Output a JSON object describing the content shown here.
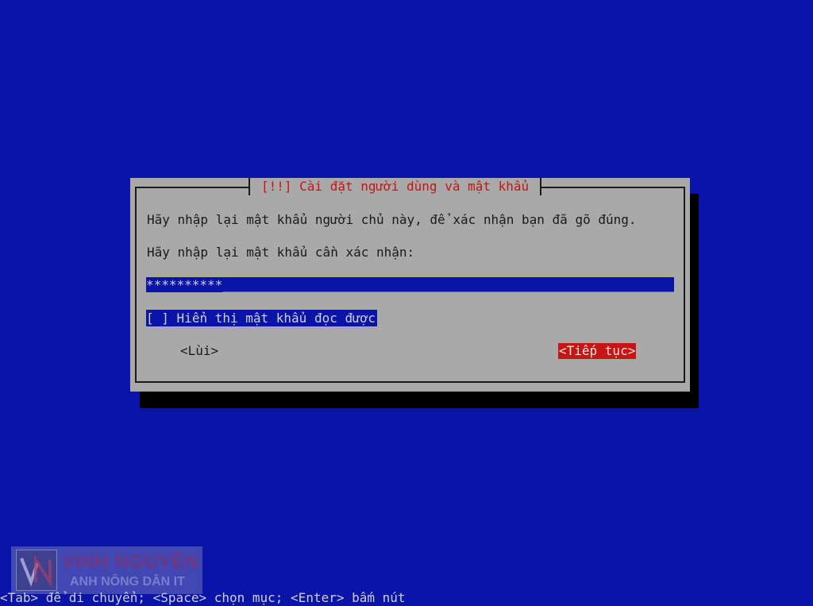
{
  "dialog": {
    "title": "[!!] Cài đặt người dùng và mật khẩu",
    "instruction": "Hãy nhập lại mật khẩu người chủ này, để xác nhận bạn đã gõ đúng.",
    "field_label": "Hãy nhập lại mật khẩu cần xác nhận:",
    "password_masked": "**********",
    "password_fill": "____________________________________________________________________",
    "show_password_checkbox": "[ ]",
    "show_password_label": "Hiển thị mật khẩu đọc được",
    "back_button": "<Lùi>",
    "continue_button": "<Tiếp tục>"
  },
  "status_bar": {
    "help_text": "<Tab> để di chuyển; <Space> chọn mục; <Enter> bấm nút"
  },
  "watermark": {
    "name": "VINH NGUYỄN",
    "subtitle": "ANH NÔNG DÂN IT"
  },
  "colors": {
    "background": "#0a14a8",
    "dialog": "#a9a9a9",
    "title_text": "#c81414",
    "focus_button": "#c81414"
  }
}
